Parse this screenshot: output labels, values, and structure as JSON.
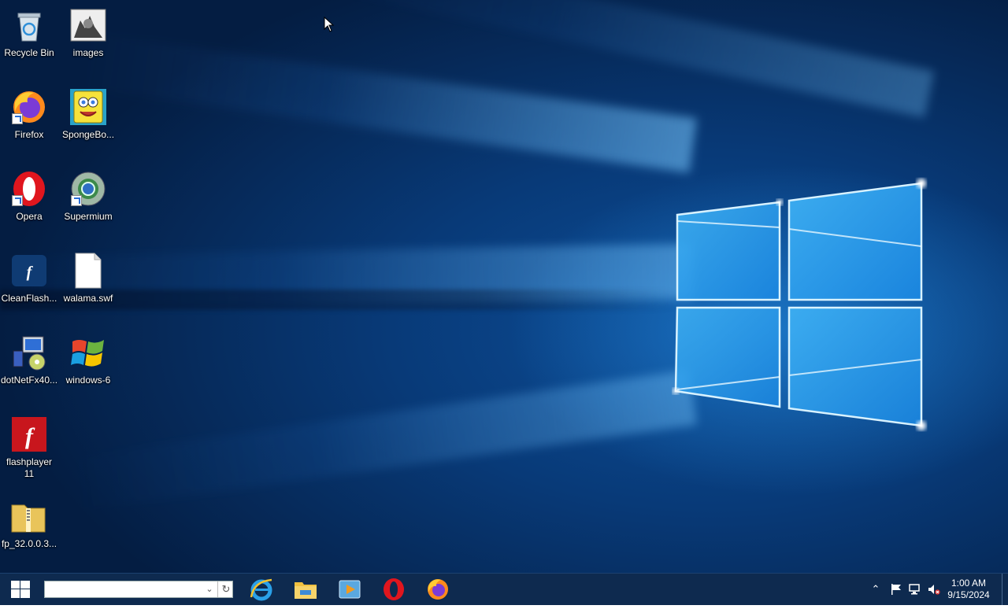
{
  "desktop": {
    "icons": [
      {
        "label": "Recycle Bin",
        "icon": "recycle-bin-icon"
      },
      {
        "label": "images",
        "icon": "image-file-icon"
      },
      {
        "label": "Firefox",
        "icon": "firefox-icon"
      },
      {
        "label": "SpongeBo...",
        "icon": "spongebob-image-icon"
      },
      {
        "label": "Opera",
        "icon": "opera-icon"
      },
      {
        "label": "Supermium",
        "icon": "supermium-icon"
      },
      {
        "label": "CleanFlash...",
        "icon": "flash-player-icon"
      },
      {
        "label": "walama.swf",
        "icon": "blank-file-icon"
      },
      {
        "label": "dotNetFx40...",
        "icon": "installer-icon"
      },
      {
        "label": "windows-6",
        "icon": "windows-flag-icon"
      },
      {
        "label": "flashplayer\n11",
        "icon": "flash-player-icon"
      },
      {
        "label": "fp_32.0.0.3...",
        "icon": "zip-folder-icon"
      }
    ]
  },
  "taskbar": {
    "search": {
      "value": "",
      "placeholder": ""
    },
    "pinned": [
      {
        "name": "Internet Explorer",
        "icon": "internet-explorer-icon"
      },
      {
        "name": "File Explorer",
        "icon": "folder-icon"
      },
      {
        "name": "Media Player",
        "icon": "media-player-icon"
      },
      {
        "name": "Opera",
        "icon": "opera-icon"
      },
      {
        "name": "Firefox",
        "icon": "firefox-icon"
      }
    ],
    "tray": {
      "time": "1:00 AM",
      "date": "9/15/2024"
    }
  },
  "colors": {
    "taskbar": "#0e2a4f",
    "desktop_blue": "#0d4f9a",
    "logo_glow": "#5fc4ff"
  }
}
